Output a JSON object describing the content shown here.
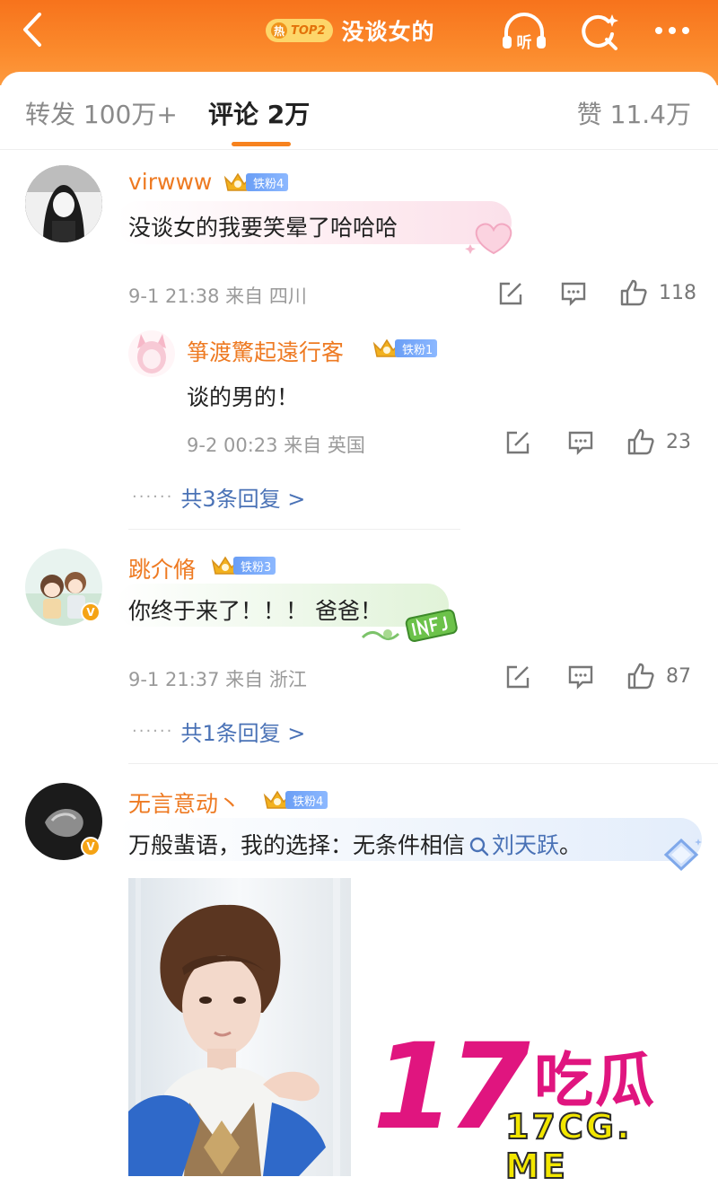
{
  "header": {
    "hot_label": "热",
    "rank_label": "TOP2",
    "title": "没谈女的",
    "listen_label": "听",
    "back_icon": "chevron-left-icon",
    "search_icon": "search-sparkle-icon",
    "more_icon": "more-dots-icon"
  },
  "tabs": {
    "repost": "转发 100万+",
    "comment": "评论 2万",
    "like": "赞 11.4万"
  },
  "comments": [
    {
      "username": "virwww",
      "fan_level": "铁粉4",
      "text": "没谈女的我要笑晕了哈哈哈",
      "meta": "9-1 21:38 来自 四川",
      "likes": "118",
      "reply": {
        "username": "箏渡驚起遠行客",
        "fan_level": "铁粉1",
        "text": "谈的男的！",
        "meta": "9-2 00:23 来自 英国",
        "likes": "23"
      },
      "replies_link": "共3条回复 >"
    },
    {
      "username": "跳介脩",
      "fan_level": "铁粉3",
      "text": "你终于来了！！！ 爸爸！",
      "meta": "9-1 21:37 来自 浙江",
      "likes": "87",
      "replies_link": "共1条回复 >",
      "verified": "V"
    },
    {
      "username": "无言意动丶",
      "fan_level": "铁粉4",
      "text_before": "万般蜚语，我的选择：无条件相信",
      "mention": "刘天跃",
      "text_after": "。",
      "verified": "V"
    }
  ],
  "watermark": {
    "number": "17",
    "name": "吃瓜",
    "url": "17CG. ME"
  },
  "colors": {
    "header_orange": "#f7731c",
    "username_orange": "#ee7a22",
    "link_blue": "#4a72b6",
    "watermark_pink": "#e0157f",
    "watermark_yellow": "#f2e600"
  }
}
